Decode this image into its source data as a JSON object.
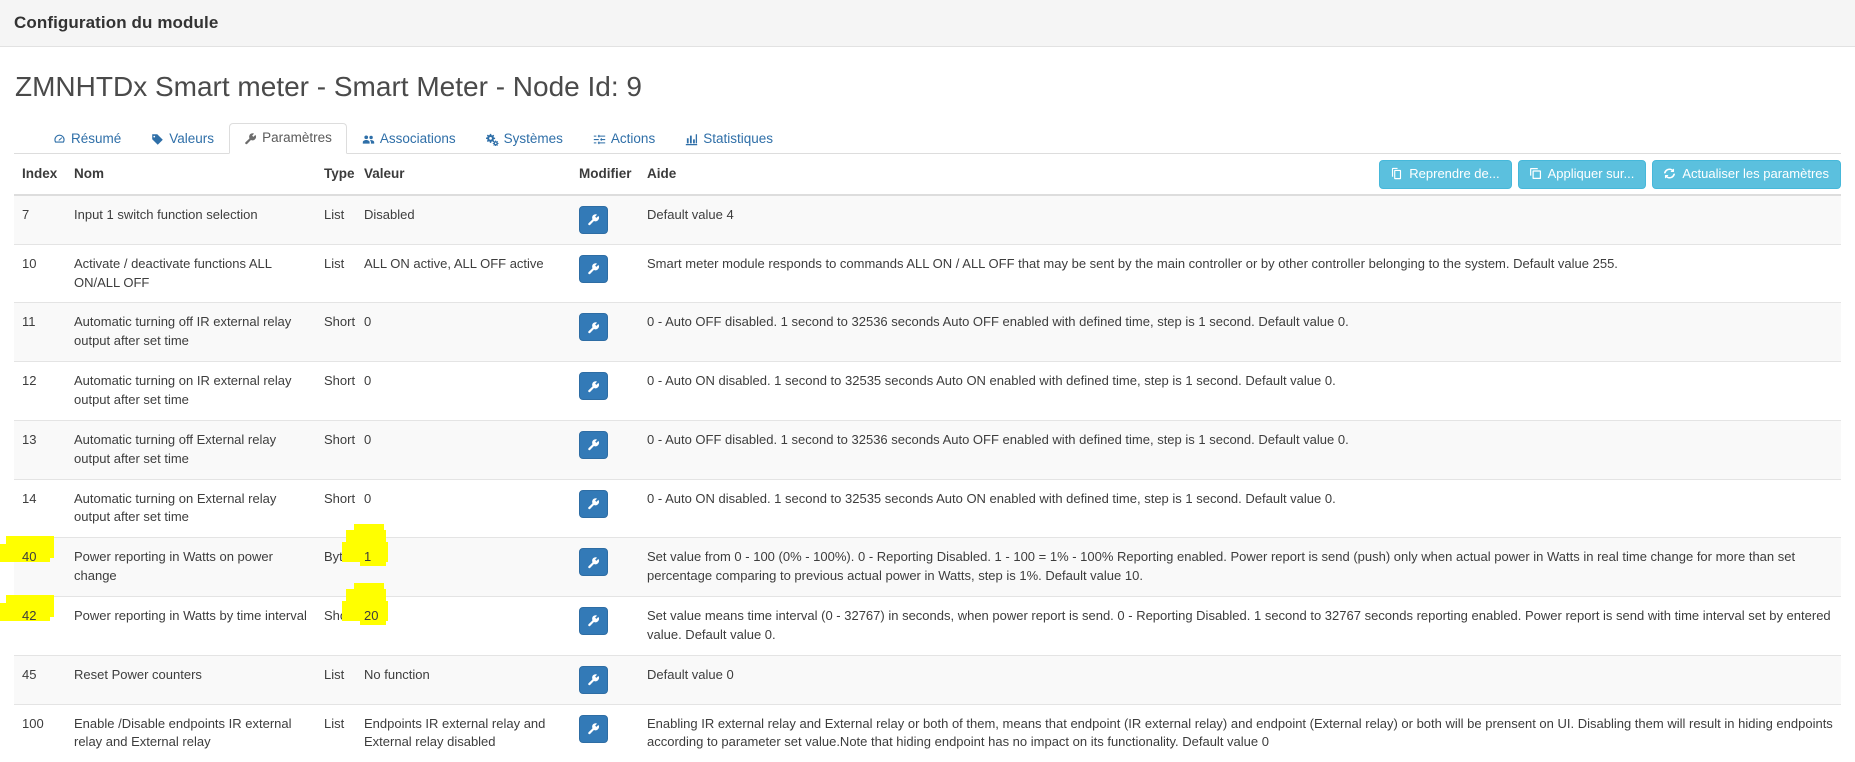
{
  "window": {
    "title": "Configuration du module"
  },
  "page": {
    "heading": "ZMNHTDx Smart meter - Smart Meter - Node Id: 9"
  },
  "tabs": [
    {
      "label": "Résumé",
      "icon": "dashboard-icon",
      "active": false
    },
    {
      "label": "Valeurs",
      "icon": "tag-icon",
      "active": false
    },
    {
      "label": "Paramètres",
      "icon": "wrench-icon",
      "active": true
    },
    {
      "label": "Associations",
      "icon": "users-icon",
      "active": false
    },
    {
      "label": "Systèmes",
      "icon": "cogs-icon",
      "active": false
    },
    {
      "label": "Actions",
      "icon": "sliders-icon",
      "active": false
    },
    {
      "label": "Statistiques",
      "icon": "bar-chart-icon",
      "active": false
    }
  ],
  "toolbar": {
    "buttons": [
      {
        "label": "Reprendre de...",
        "icon": "copy-icon"
      },
      {
        "label": "Appliquer sur...",
        "icon": "clone-icon"
      },
      {
        "label": "Actualiser les paramètres",
        "icon": "refresh-icon"
      }
    ]
  },
  "table": {
    "columns": [
      "Index",
      "Nom",
      "Type",
      "Valeur",
      "Modifier",
      "Aide"
    ],
    "edit_icon": "wrench-icon",
    "rows": [
      {
        "index": "7",
        "nom": "Input 1 switch function selection",
        "type": "List",
        "valeur": "Disabled",
        "aide": "Default value 4",
        "highlight_index": false,
        "highlight_value": false
      },
      {
        "index": "10",
        "nom": "Activate / deactivate functions ALL ON/ALL OFF",
        "type": "List",
        "valeur": "ALL ON active, ALL OFF active",
        "aide": "Smart meter module responds to commands ALL ON / ALL OFF that may be sent by the main controller or by other controller belonging to the system. Default value 255.",
        "highlight_index": false,
        "highlight_value": false
      },
      {
        "index": "11",
        "nom": "Automatic turning off IR external relay output after set time",
        "type": "Short",
        "valeur": "0",
        "aide": "0 - Auto OFF disabled. 1 second to 32536 seconds Auto OFF enabled with defined time, step is 1 second. Default value 0.",
        "highlight_index": false,
        "highlight_value": false
      },
      {
        "index": "12",
        "nom": "Automatic turning on IR external relay output after set time",
        "type": "Short",
        "valeur": "0",
        "aide": "0 - Auto ON disabled. 1 second to 32535 seconds Auto ON enabled with defined time, step is 1 second. Default value 0.",
        "highlight_index": false,
        "highlight_value": false
      },
      {
        "index": "13",
        "nom": "Automatic turning off External relay output after set time",
        "type": "Short",
        "valeur": "0",
        "aide": "0 - Auto OFF disabled. 1 second to 32536 seconds Auto OFF enabled with defined time, step is 1 second. Default value 0.",
        "highlight_index": false,
        "highlight_value": false
      },
      {
        "index": "14",
        "nom": "Automatic turning on External relay output after set time",
        "type": "Short",
        "valeur": "0",
        "aide": "0 - Auto ON disabled. 1 second to 32535 seconds Auto ON enabled with defined time, step is 1 second. Default value 0.",
        "highlight_index": false,
        "highlight_value": false
      },
      {
        "index": "40",
        "nom": "Power reporting in Watts on power change",
        "type": "Byte",
        "valeur": "1",
        "aide": "Set value from 0 - 100 (0% - 100%). 0 - Reporting Disabled. 1 - 100 = 1% - 100% Reporting enabled. Power report is send (push) only when actual power in Watts in real time change for more than set percentage comparing to previous actual power in Watts, step is 1%. Default value 10.",
        "highlight_index": true,
        "highlight_value": true
      },
      {
        "index": "42",
        "nom": "Power reporting in Watts by time interval",
        "type": "Short",
        "valeur": "20",
        "aide": "Set value means time interval (0 - 32767) in seconds, when power report is send. 0 - Reporting Disabled. 1 second to 32767 seconds reporting enabled. Power report is send with time interval set by entered value. Default value 0.",
        "highlight_index": true,
        "highlight_value": true
      },
      {
        "index": "45",
        "nom": "Reset Power counters",
        "type": "List",
        "valeur": "No function",
        "aide": "Default value 0",
        "highlight_index": false,
        "highlight_value": false
      },
      {
        "index": "100",
        "nom": "Enable /Disable endpoints IR external relay and External relay",
        "type": "List",
        "valeur": "Endpoints IR external relay and External relay disabled",
        "aide": "Enabling IR external relay and External relay or both of them, means that endpoint (IR external relay) and endpoint (External relay) or both will be prensent on UI. Disabling them will result in hiding endpoints according to parameter set value.Note that hiding endpoint has no impact on its functionality. Default value 0",
        "highlight_index": false,
        "highlight_value": false
      }
    ]
  },
  "colors": {
    "topbar_bg": "#f5f5f5",
    "tab_link": "#2f6fa8",
    "toolbar_button": "#5bc0de",
    "edit_button": "#337ab7",
    "highlighter": "#ffff00",
    "row_stripe": "#f9f9f9"
  }
}
